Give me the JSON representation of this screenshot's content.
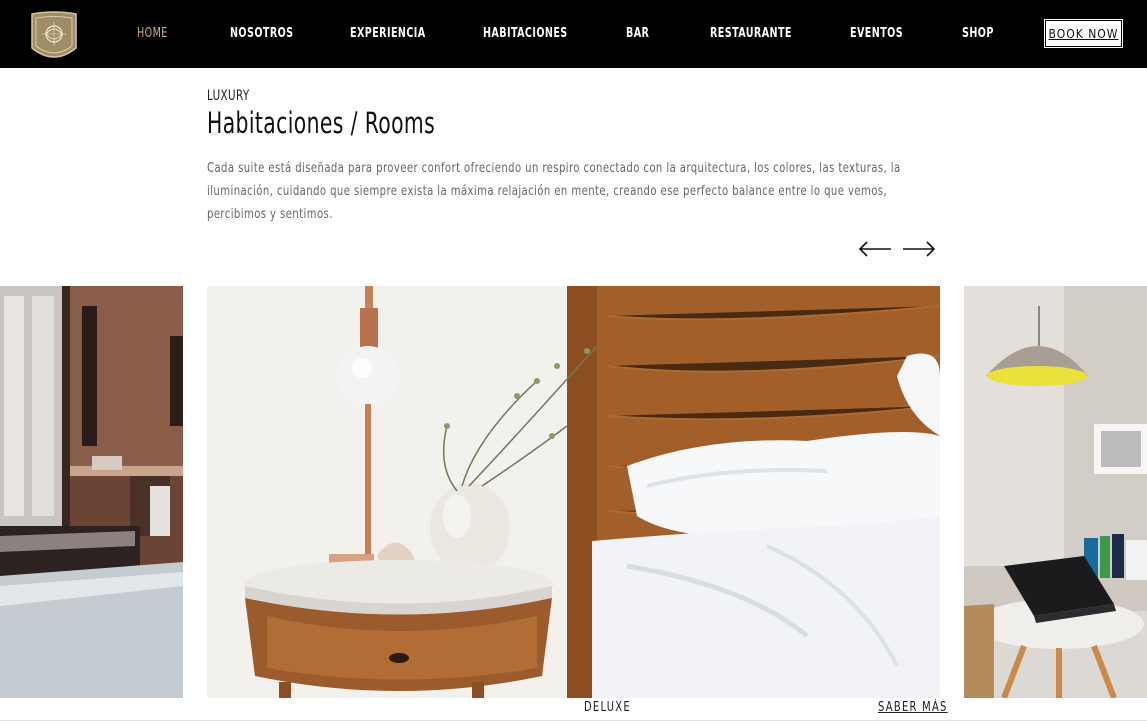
{
  "nav": {
    "items": [
      {
        "label": "HOME"
      },
      {
        "label": "NOSOTROS"
      },
      {
        "label": "EXPERIENCIA"
      },
      {
        "label": "HABITACIONES"
      },
      {
        "label": "BAR"
      },
      {
        "label": "RESTAURANTE"
      },
      {
        "label": "EVENTOS"
      },
      {
        "label": "SHOP"
      }
    ],
    "active": "HOME",
    "book_label": "BOOK NOW",
    "logo_icon": "hotel-crest-icon"
  },
  "intro": {
    "eyebrow": "LUXURY",
    "title": "Habitaciones / Rooms",
    "description": "Cada suite está diseñada para proveer confort ofreciendo un respiro conectado con la arquitectura, los colores, las texturas, la iluminación, cuidando que siempre exista la máxima relajación en mente, creando ese perfecto balance entre lo que vemos, percibimos y sentimos."
  },
  "carousel": {
    "prev_icon": "arrow-left-icon",
    "next_icon": "arrow-right-icon",
    "current": {
      "label": "DELUXE",
      "more_label": "SABER MÁS"
    }
  },
  "colors": {
    "nav_bg": "#000000",
    "accent_gold": "#c9b184",
    "text": "#666666"
  }
}
